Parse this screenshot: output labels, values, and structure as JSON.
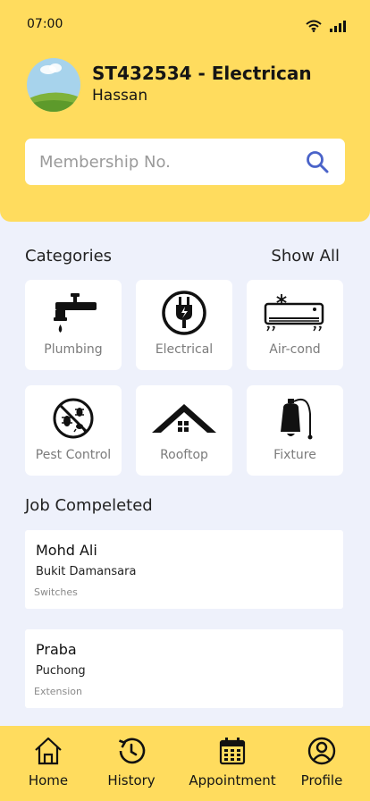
{
  "status_bar": {
    "time": "07:00"
  },
  "profile": {
    "title": "ST432534 - Electrican",
    "name": "Hassan"
  },
  "search": {
    "placeholder": "Membership No."
  },
  "categories": {
    "heading": "Categories",
    "show_all": "Show All",
    "items": [
      {
        "label": "Plumbing",
        "icon": "faucet-icon"
      },
      {
        "label": "Electrical",
        "icon": "plug-icon"
      },
      {
        "label": "Air-cond",
        "icon": "air-conditioner-icon"
      },
      {
        "label": "Pest Control",
        "icon": "no-pests-icon"
      },
      {
        "label": "Rooftop",
        "icon": "roof-icon"
      },
      {
        "label": "Fixture",
        "icon": "lamp-icon"
      }
    ]
  },
  "jobs": {
    "heading": "Job Compeleted",
    "items": [
      {
        "name": "Mohd Ali",
        "location": "Bukit Damansara",
        "type": "Switches"
      },
      {
        "name": "Praba",
        "location": "Puchong",
        "type": "Extension"
      }
    ]
  },
  "nav": {
    "items": [
      {
        "label": "Home",
        "icon": "home-icon"
      },
      {
        "label": "History",
        "icon": "history-icon"
      },
      {
        "label": "Appointment",
        "icon": "calendar-icon"
      },
      {
        "label": "Profile",
        "icon": "user-icon"
      }
    ]
  },
  "colors": {
    "accent": "#ffdc5e",
    "background": "#eef1fb",
    "search_icon": "#4a63c9"
  }
}
